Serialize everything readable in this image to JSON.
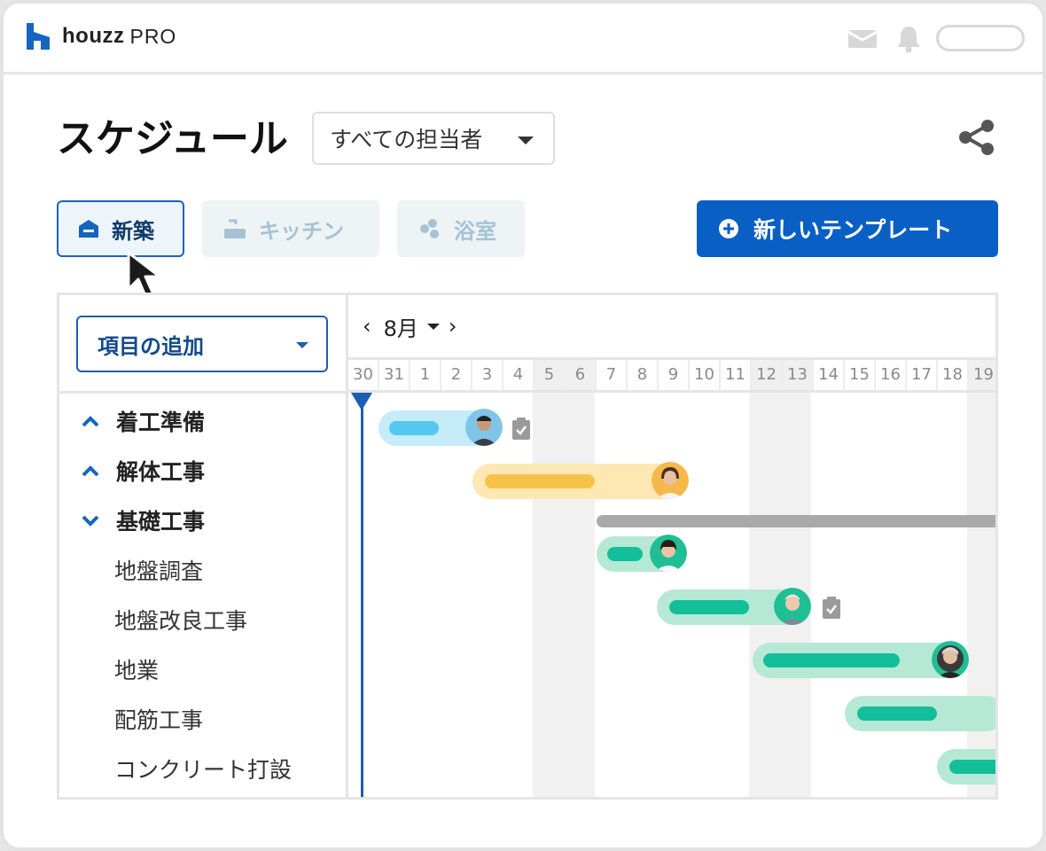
{
  "header": {
    "brand": "houzz",
    "brand_suffix": "PRO",
    "brand_color": "#1565c0"
  },
  "page": {
    "title": "スケジュール",
    "assignee_filter": "すべての担当者"
  },
  "templates": {
    "chips": [
      {
        "label": "新築",
        "icon": "house-icon",
        "state": "selected"
      },
      {
        "label": "キッチン",
        "icon": "faucet-icon",
        "state": "inactive"
      },
      {
        "label": "浴室",
        "icon": "bubbles-icon",
        "state": "inactive"
      }
    ],
    "new_template_label": "新しいテンプレート",
    "accent_color": "#0a5fc5"
  },
  "schedule": {
    "add_item_label": "項目の追加",
    "month_label": "8月",
    "days": [
      "30",
      "31",
      "1",
      "2",
      "3",
      "4",
      "5",
      "6",
      "7",
      "8",
      "9",
      "10",
      "11",
      "12",
      "13",
      "14",
      "15",
      "16",
      "17",
      "18",
      "19"
    ],
    "tasks": [
      {
        "label": "着工準備",
        "type": "group",
        "expanded": false
      },
      {
        "label": "解体工事",
        "type": "group",
        "expanded": false
      },
      {
        "label": "基礎工事",
        "type": "group",
        "expanded": true
      },
      {
        "label": "地盤調査",
        "type": "sub"
      },
      {
        "label": "地盤改良工事",
        "type": "sub"
      },
      {
        "label": "地業",
        "type": "sub"
      },
      {
        "label": "配筋工事",
        "type": "sub"
      },
      {
        "label": "コンクリート打設",
        "type": "sub"
      }
    ],
    "bar_colors": {
      "blue": "#c5ecf8",
      "blue_inner": "#55c8ef",
      "yellow": "#fde7b2",
      "yellow_inner": "#f7c24a",
      "green": "#b6e8d6",
      "green_inner": "#12bf98",
      "summary": "#a9a9a9",
      "today": "#1a5fb4"
    }
  }
}
